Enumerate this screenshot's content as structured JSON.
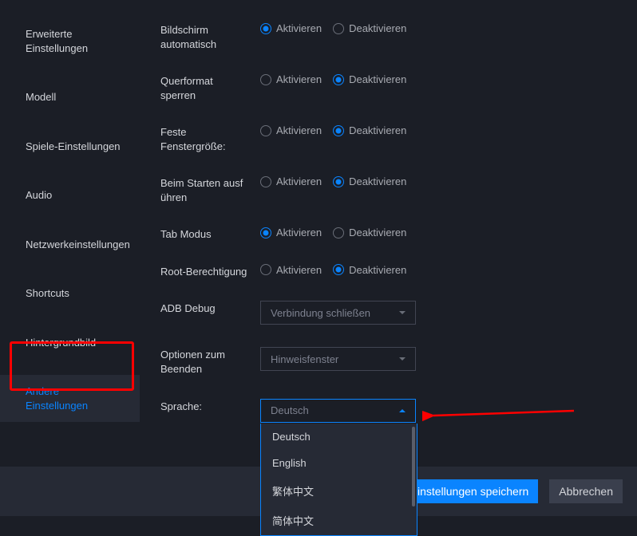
{
  "sidebar": {
    "items": [
      {
        "lines": [
          "Erweiterte",
          "Einstellungen"
        ]
      },
      {
        "lines": [
          "Modell"
        ]
      },
      {
        "lines": [
          "Spiele-Einstellungen"
        ]
      },
      {
        "lines": [
          "Audio"
        ]
      },
      {
        "lines": [
          "Netzwerkeinstellungen"
        ]
      },
      {
        "lines": [
          "Shortcuts"
        ]
      },
      {
        "lines": [
          "Hintergrundbild"
        ]
      },
      {
        "lines": [
          "Andere",
          "Einstellungen"
        ]
      }
    ]
  },
  "radio": {
    "activate": "Aktivieren",
    "deactivate": "Deaktivieren"
  },
  "rows": {
    "r0": {
      "label1": "Bildschirm",
      "label2": "automatisch"
    },
    "r1": {
      "label1": "Querformat",
      "label2": "sperren"
    },
    "r2": {
      "label1": "Feste",
      "label2": "Fenstergröße:"
    },
    "r3": {
      "label1": "Beim Starten ausf",
      "label2": "ühren"
    },
    "r4": {
      "label1": "Tab Modus"
    },
    "r5": {
      "label1": "Root-Berechtigung"
    }
  },
  "adb": {
    "label": "ADB Debug",
    "value": "Verbindung schließen"
  },
  "exit": {
    "label1": "Optionen zum",
    "label2": "Beenden",
    "value": "Hinweisfenster"
  },
  "language": {
    "label": "Sprache:",
    "selected": "Deutsch",
    "options": [
      "Deutsch",
      "English",
      "繁体中文",
      "简体中文"
    ]
  },
  "footer": {
    "save": "Einstellungen speichern",
    "cancel": "Abbrechen"
  }
}
